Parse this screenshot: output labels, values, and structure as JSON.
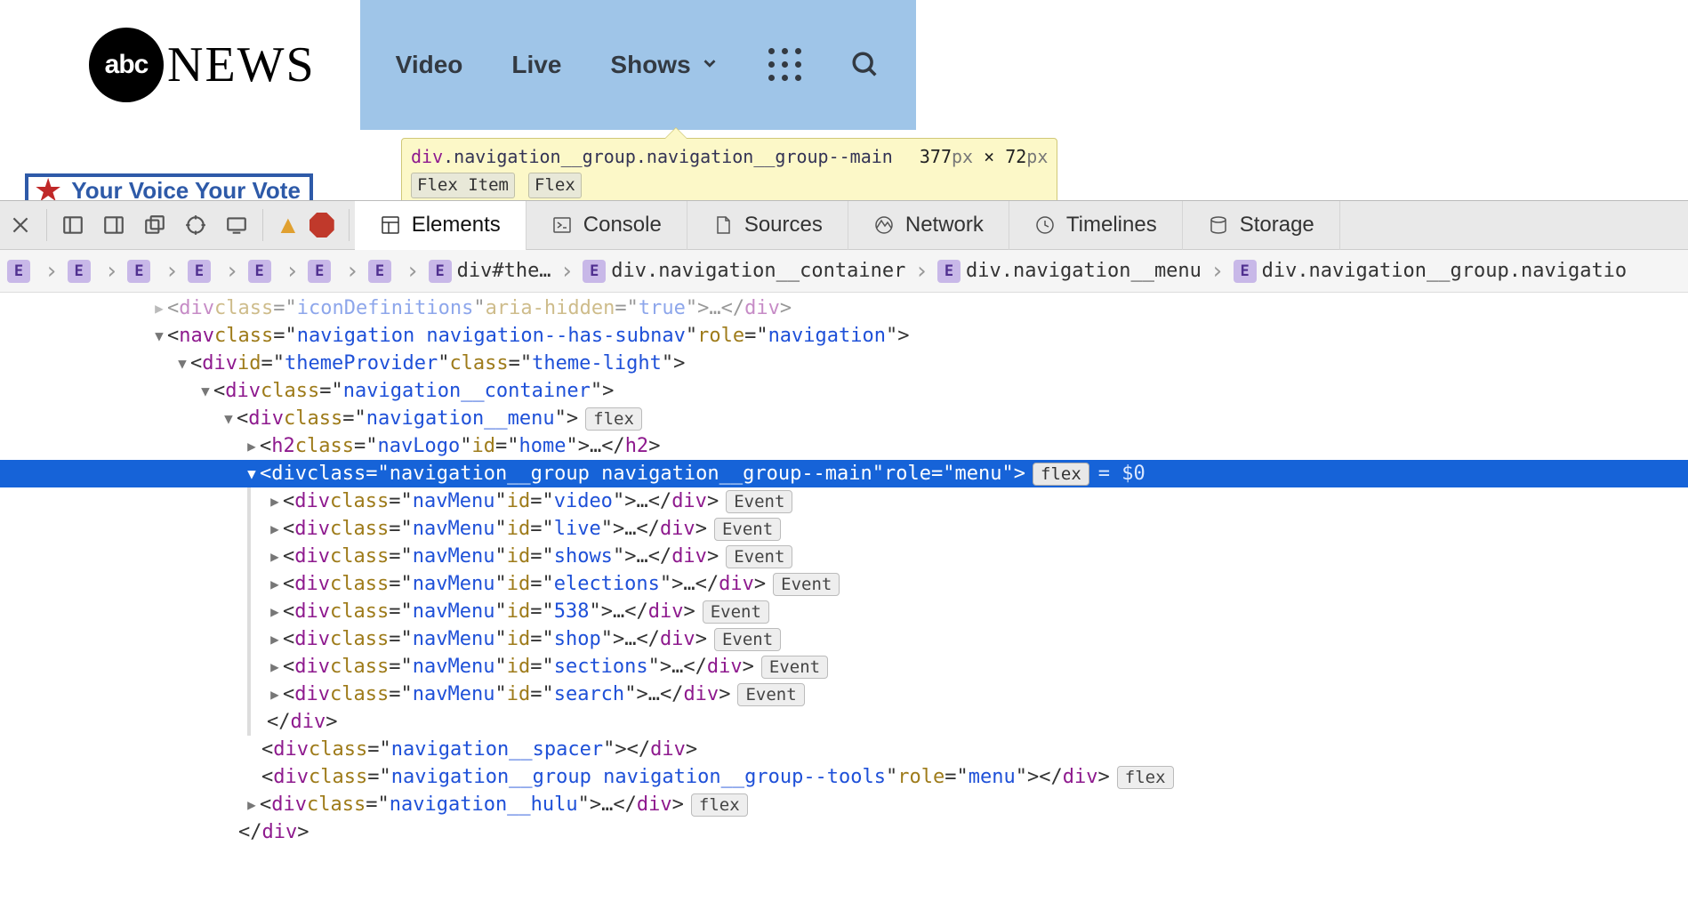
{
  "website": {
    "logo": {
      "circle_text": "abc",
      "word": "NEWS"
    },
    "nav": {
      "video": "Video",
      "live": "Live",
      "shows": "Shows"
    },
    "banner_partial_text": "Your Voice Your Vote"
  },
  "inspect_tooltip": {
    "tag": "div",
    "classes": ".navigation__group.navigation__group--main",
    "width": "377",
    "height": "72",
    "px": "px",
    "times": " × ",
    "badge1": "Flex Item",
    "badge2": "Flex"
  },
  "devtools_tabs": {
    "elements": "Elements",
    "console": "Console",
    "sources": "Sources",
    "network": "Network",
    "timelines": "Timelines",
    "storage": "Storage"
  },
  "breadcrumb": {
    "e": "E",
    "item_theme": "div#the…",
    "item_container": "div.navigation__container",
    "item_menu": "div.navigation__menu",
    "item_group": "div.navigation__group.navigatio"
  },
  "badges": {
    "flex": "flex",
    "event": "Event",
    "eq0": "= $0"
  },
  "tokens": {
    "lt": "<",
    "gt": ">",
    "lt_close": "</",
    "eq": "=",
    "q": "\"",
    "ell": "…",
    "div": "div",
    "nav": "nav",
    "h2": "h2",
    "class": "class",
    "id": "id",
    "role": "role",
    "aria_hidden": "aria-hidden"
  },
  "values": {
    "iconDefinitions": "iconDefinitions",
    "true": "true",
    "nav_cls": "navigation navigation--has-subnav",
    "navigation": "navigation",
    "themeProvider": "themeProvider",
    "theme_light": "theme-light ",
    "navigation__container": "navigation__container",
    "navigation__menu": "navigation__menu",
    "navLogo": "navLogo",
    "home": "home",
    "group_main": "navigation__group navigation__group--main",
    "menu": "menu",
    "navMenu": "navMenu",
    "video": "video",
    "live": "live",
    "shows": "shows",
    "elections": "elections",
    "n538": "538",
    "shop": "shop",
    "sections": "sections",
    "search": "search",
    "navigation__spacer": "navigation__spacer",
    "group_tools": "navigation__group navigation__group--tools",
    "navigation__hulu": "navigation__hulu"
  },
  "indents": {
    "i0": 170,
    "i1": 196,
    "i2": 222,
    "i3": 248,
    "i4": 274,
    "i5": 300,
    "i6": 326
  }
}
